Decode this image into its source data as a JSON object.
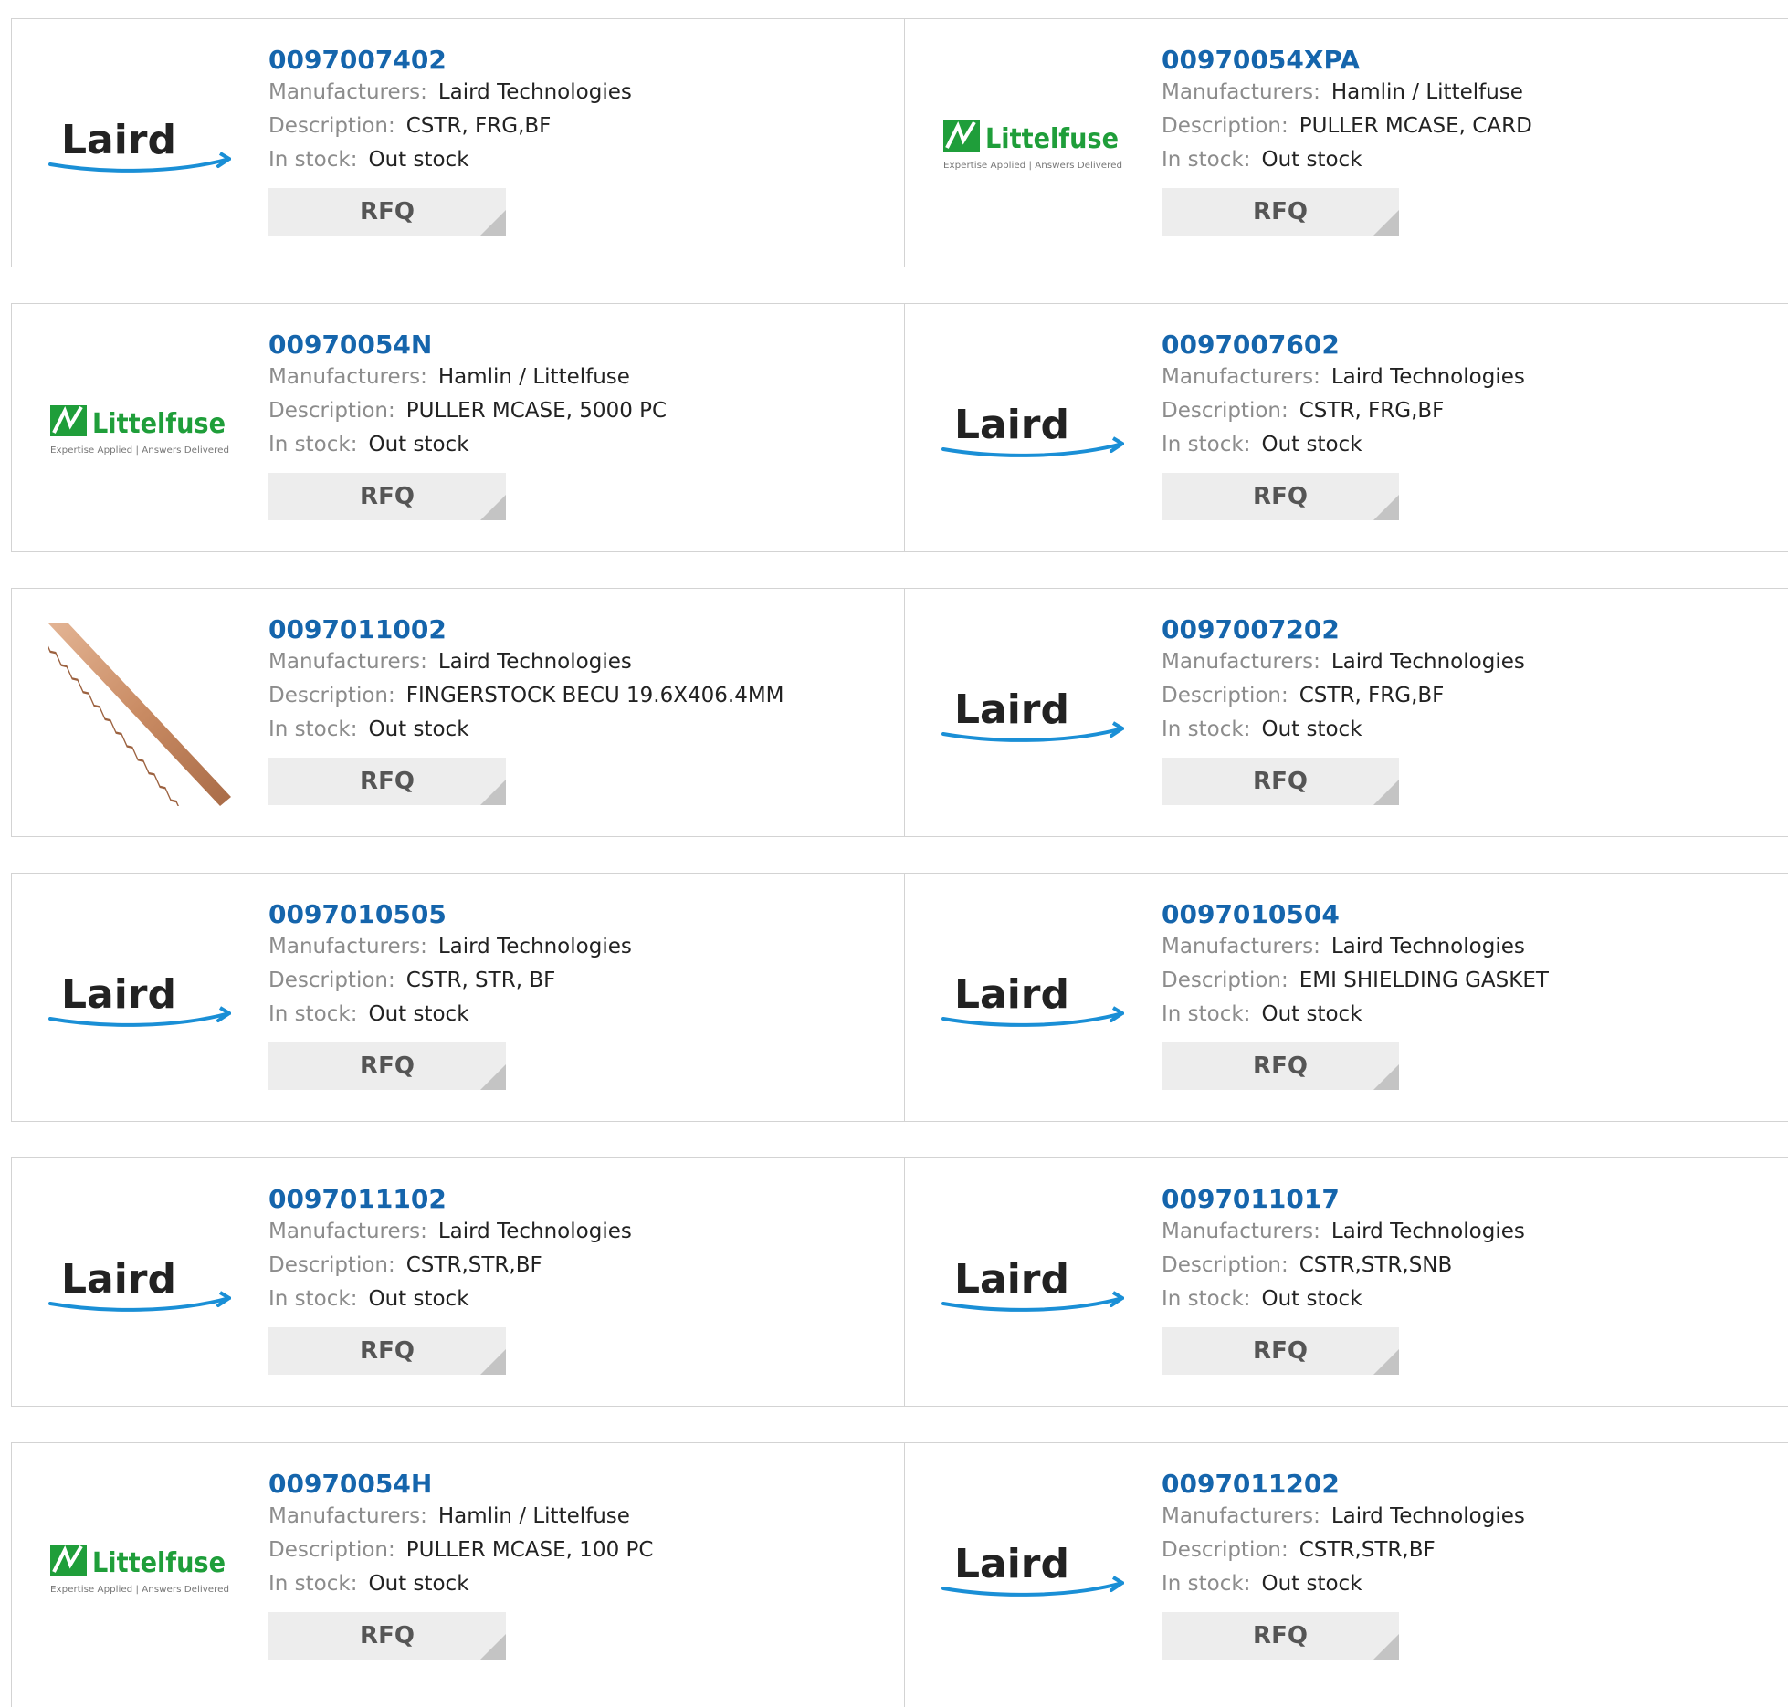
{
  "colors": {
    "part_link": "#1565ac",
    "label": "#8c8c8c",
    "value": "#222222",
    "button_bg": "#ededed",
    "border": "#d3d3d3",
    "laird_swoosh": "#1a8fd6",
    "littelfuse_green": "#1f9e3a"
  },
  "labels": {
    "manufacturers": "Manufacturers:",
    "description": "Description:",
    "in_stock": "In stock:",
    "rfq": "RFQ"
  },
  "logos": {
    "laird": {
      "text": "Laird"
    },
    "littelfuse": {
      "text": "Littelfuse",
      "tagline": "Expertise Applied | Answers Delivered"
    }
  },
  "rows": [
    [
      {
        "part": "0097007402",
        "manufacturer": "Laird Technologies",
        "description": "CSTR, FRG,BF",
        "stock": "Out stock",
        "logo": "laird"
      },
      {
        "part": "00970054XPA",
        "manufacturer": "Hamlin / Littelfuse",
        "description": "PULLER MCASE, CARD",
        "stock": "Out stock",
        "logo": "littelfuse"
      }
    ],
    [
      {
        "part": "00970054N",
        "manufacturer": "Hamlin / Littelfuse",
        "description": "PULLER MCASE, 5000 PC",
        "stock": "Out stock",
        "logo": "littelfuse"
      },
      {
        "part": "0097007602",
        "manufacturer": "Laird Technologies",
        "description": "CSTR, FRG,BF",
        "stock": "Out stock",
        "logo": "laird"
      }
    ],
    [
      {
        "part": "0097011002",
        "manufacturer": "Laird Technologies",
        "description": "FINGERSTOCK BECU 19.6X406.4MM",
        "stock": "Out stock",
        "logo": "fingerstock-photo"
      },
      {
        "part": "0097007202",
        "manufacturer": "Laird Technologies",
        "description": "CSTR, FRG,BF",
        "stock": "Out stock",
        "logo": "laird"
      }
    ],
    [
      {
        "part": "0097010505",
        "manufacturer": "Laird Technologies",
        "description": "CSTR, STR, BF",
        "stock": "Out stock",
        "logo": "laird"
      },
      {
        "part": "0097010504",
        "manufacturer": "Laird Technologies",
        "description": "EMI SHIELDING GASKET",
        "stock": "Out stock",
        "logo": "laird"
      }
    ],
    [
      {
        "part": "0097011102",
        "manufacturer": "Laird Technologies",
        "description": "CSTR,STR,BF",
        "stock": "Out stock",
        "logo": "laird"
      },
      {
        "part": "0097011017",
        "manufacturer": "Laird Technologies",
        "description": "CSTR,STR,SNB",
        "stock": "Out stock",
        "logo": "laird"
      }
    ],
    [
      {
        "part": "00970054H",
        "manufacturer": "Hamlin / Littelfuse",
        "description": "PULLER MCASE, 100 PC",
        "stock": "Out stock",
        "logo": "littelfuse"
      },
      {
        "part": "0097011202",
        "manufacturer": "Laird Technologies",
        "description": "CSTR,STR,BF",
        "stock": "Out stock",
        "logo": "laird"
      }
    ]
  ]
}
